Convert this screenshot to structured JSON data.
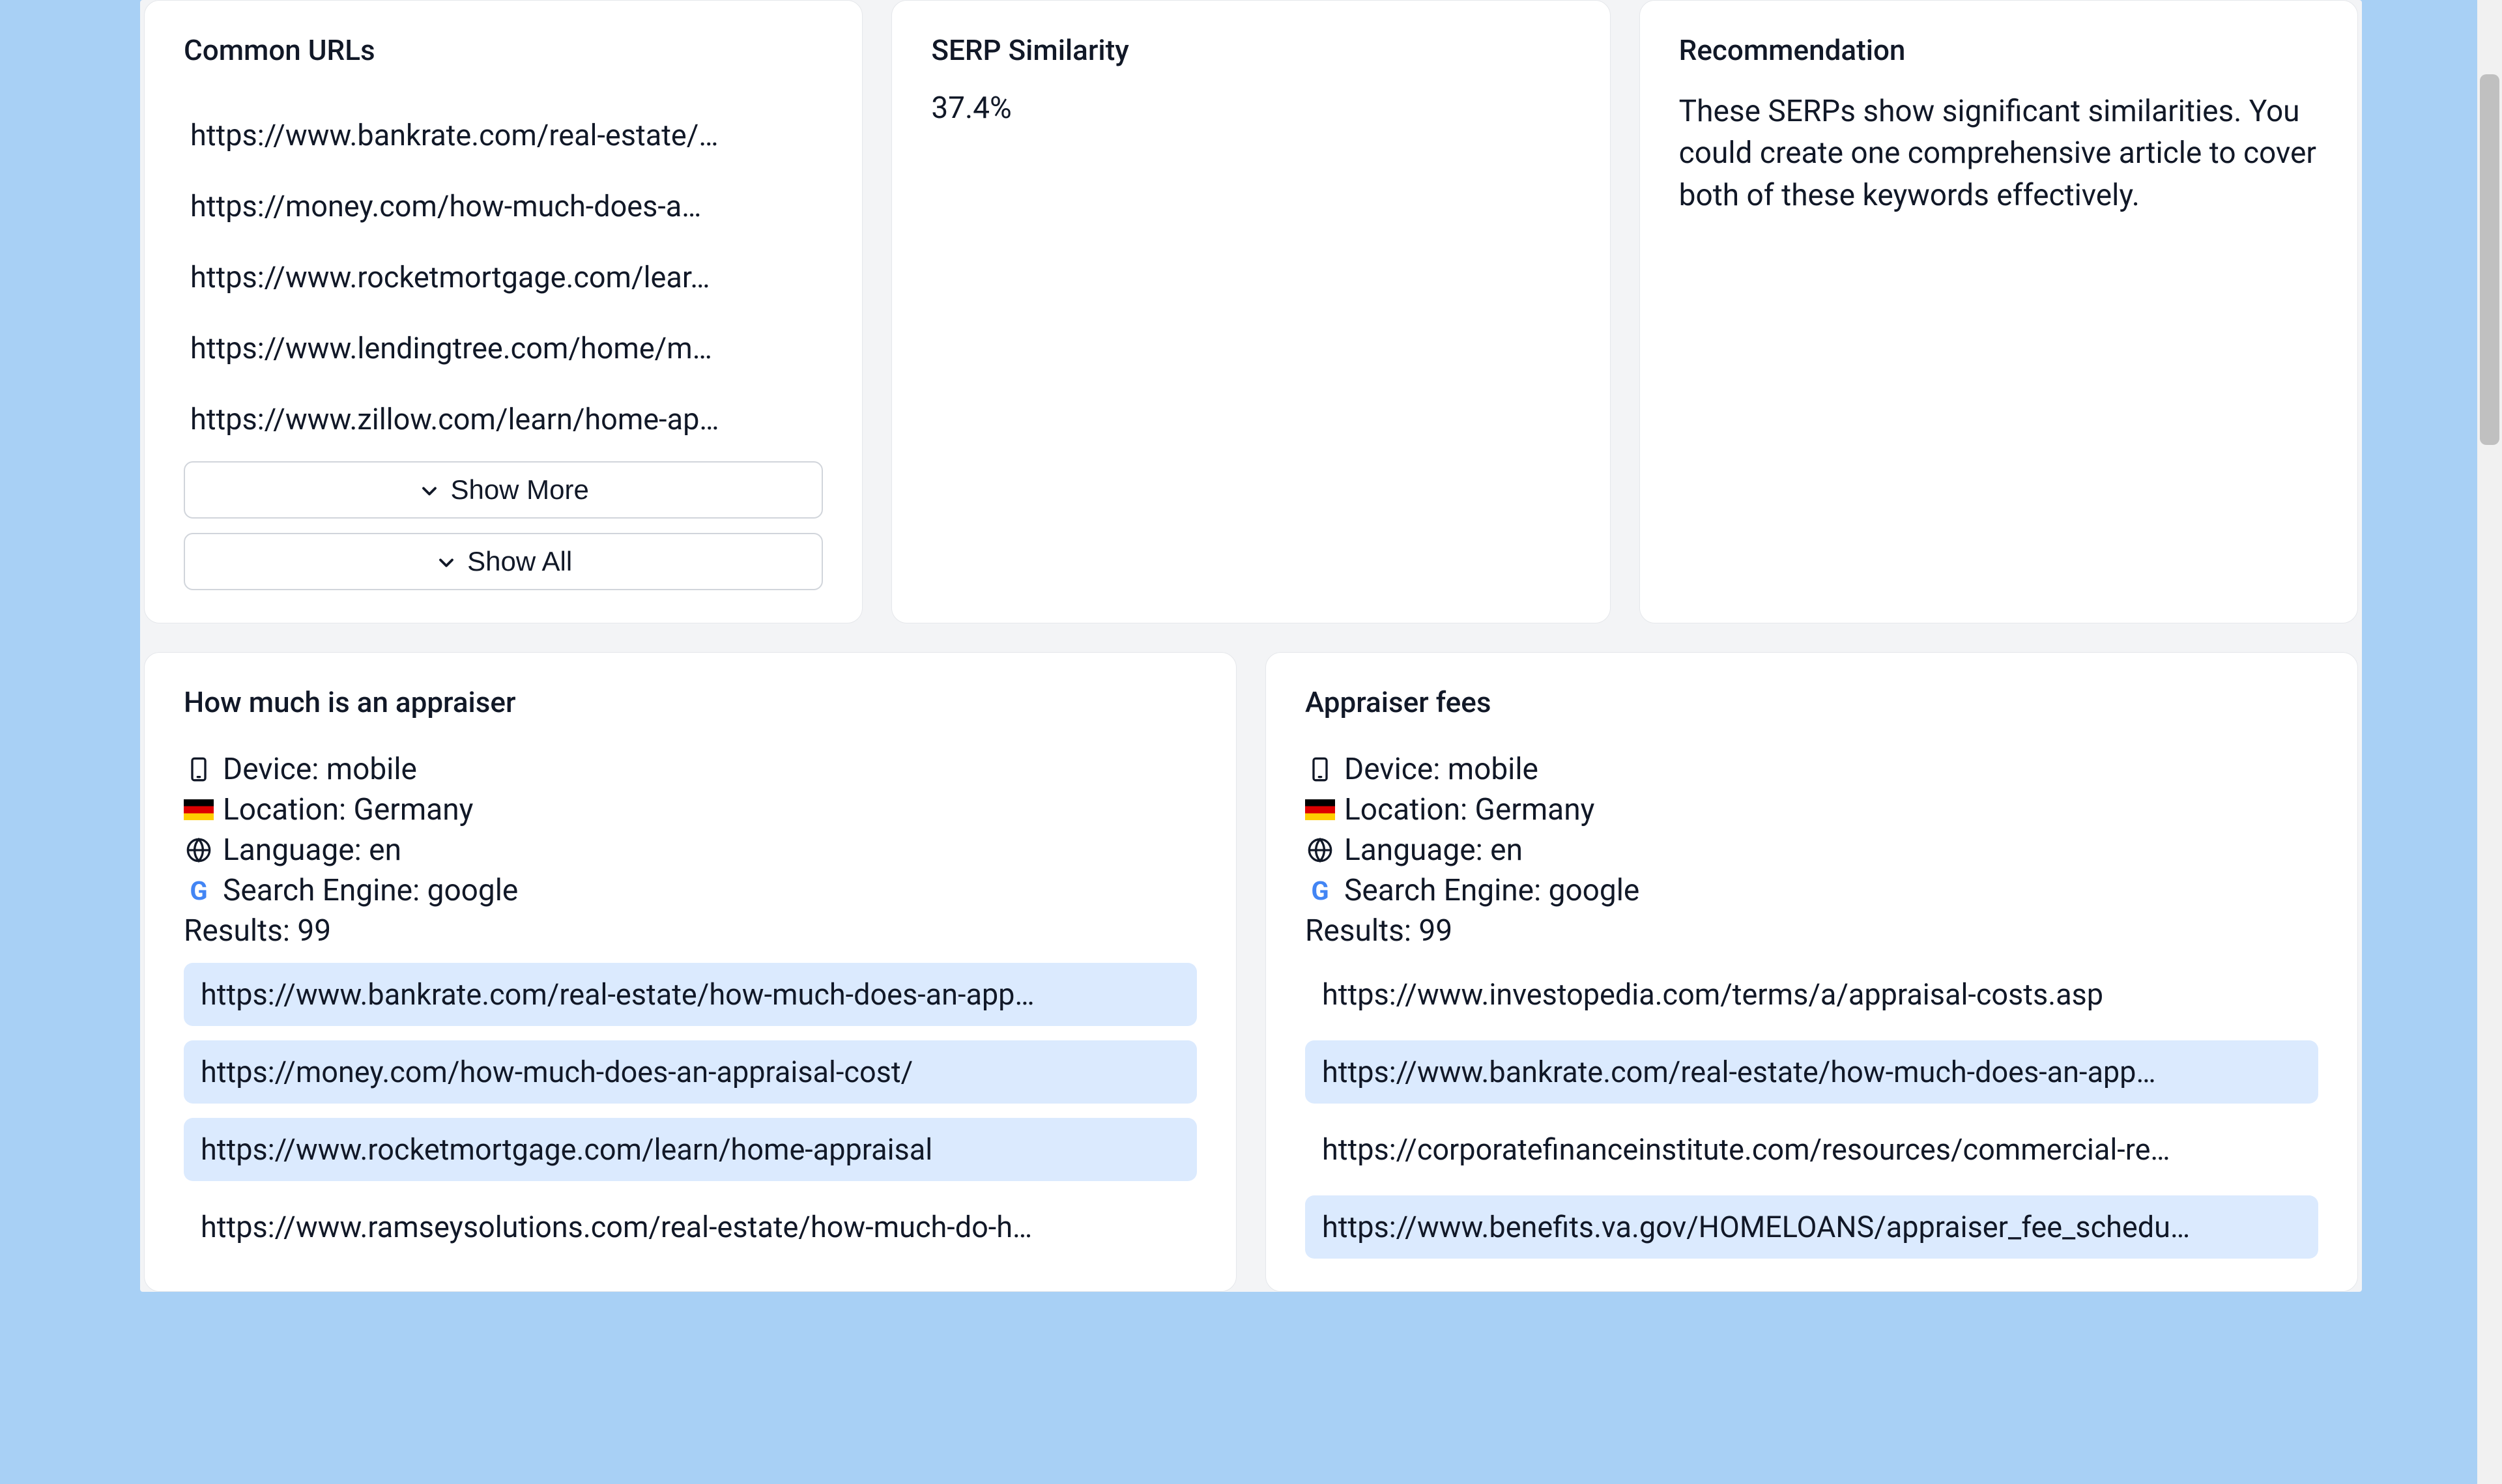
{
  "common_urls_card": {
    "title": "Common URLs",
    "urls": [
      "https://www.bankrate.com/real-estate/…",
      "https://money.com/how-much-does-a…",
      "https://www.rocketmortgage.com/lear…",
      "https://www.lendingtree.com/home/m…",
      "https://www.zillow.com/learn/home-ap…"
    ],
    "show_more_label": "Show More",
    "show_all_label": "Show All"
  },
  "serp_similarity_card": {
    "title": "SERP Similarity",
    "value": "37.4%"
  },
  "recommendation_card": {
    "title": "Recommendation",
    "text": "These SERPs show significant similarities. You could create one comprehensive article to cover both of these keywords effectively."
  },
  "serp_left": {
    "title": "How much is an appraiser",
    "device_label": "Device: mobile",
    "location_label": "Location: Germany",
    "language_label": "Language: en",
    "engine_label": "Search Engine: google",
    "results_label": "Results: 99",
    "items": [
      {
        "url": "https://www.bankrate.com/real-estate/how-much-does-an-app…",
        "highlighted": true
      },
      {
        "url": "https://money.com/how-much-does-an-appraisal-cost/",
        "highlighted": true
      },
      {
        "url": "https://www.rocketmortgage.com/learn/home-appraisal",
        "highlighted": true
      },
      {
        "url": "https://www.ramseysolutions.com/real-estate/how-much-do-h…",
        "highlighted": false
      }
    ]
  },
  "serp_right": {
    "title": "Appraiser fees",
    "device_label": "Device: mobile",
    "location_label": "Location: Germany",
    "language_label": "Language: en",
    "engine_label": "Search Engine: google",
    "results_label": "Results: 99",
    "items": [
      {
        "url": "https://www.investopedia.com/terms/a/appraisal-costs.asp",
        "highlighted": false
      },
      {
        "url": "https://www.bankrate.com/real-estate/how-much-does-an-app…",
        "highlighted": true
      },
      {
        "url": "https://corporatefinanceinstitute.com/resources/commercial-re…",
        "highlighted": false
      },
      {
        "url": "https://www.benefits.va.gov/HOMELOANS/appraiser_fee_schedu…",
        "highlighted": true
      }
    ]
  }
}
